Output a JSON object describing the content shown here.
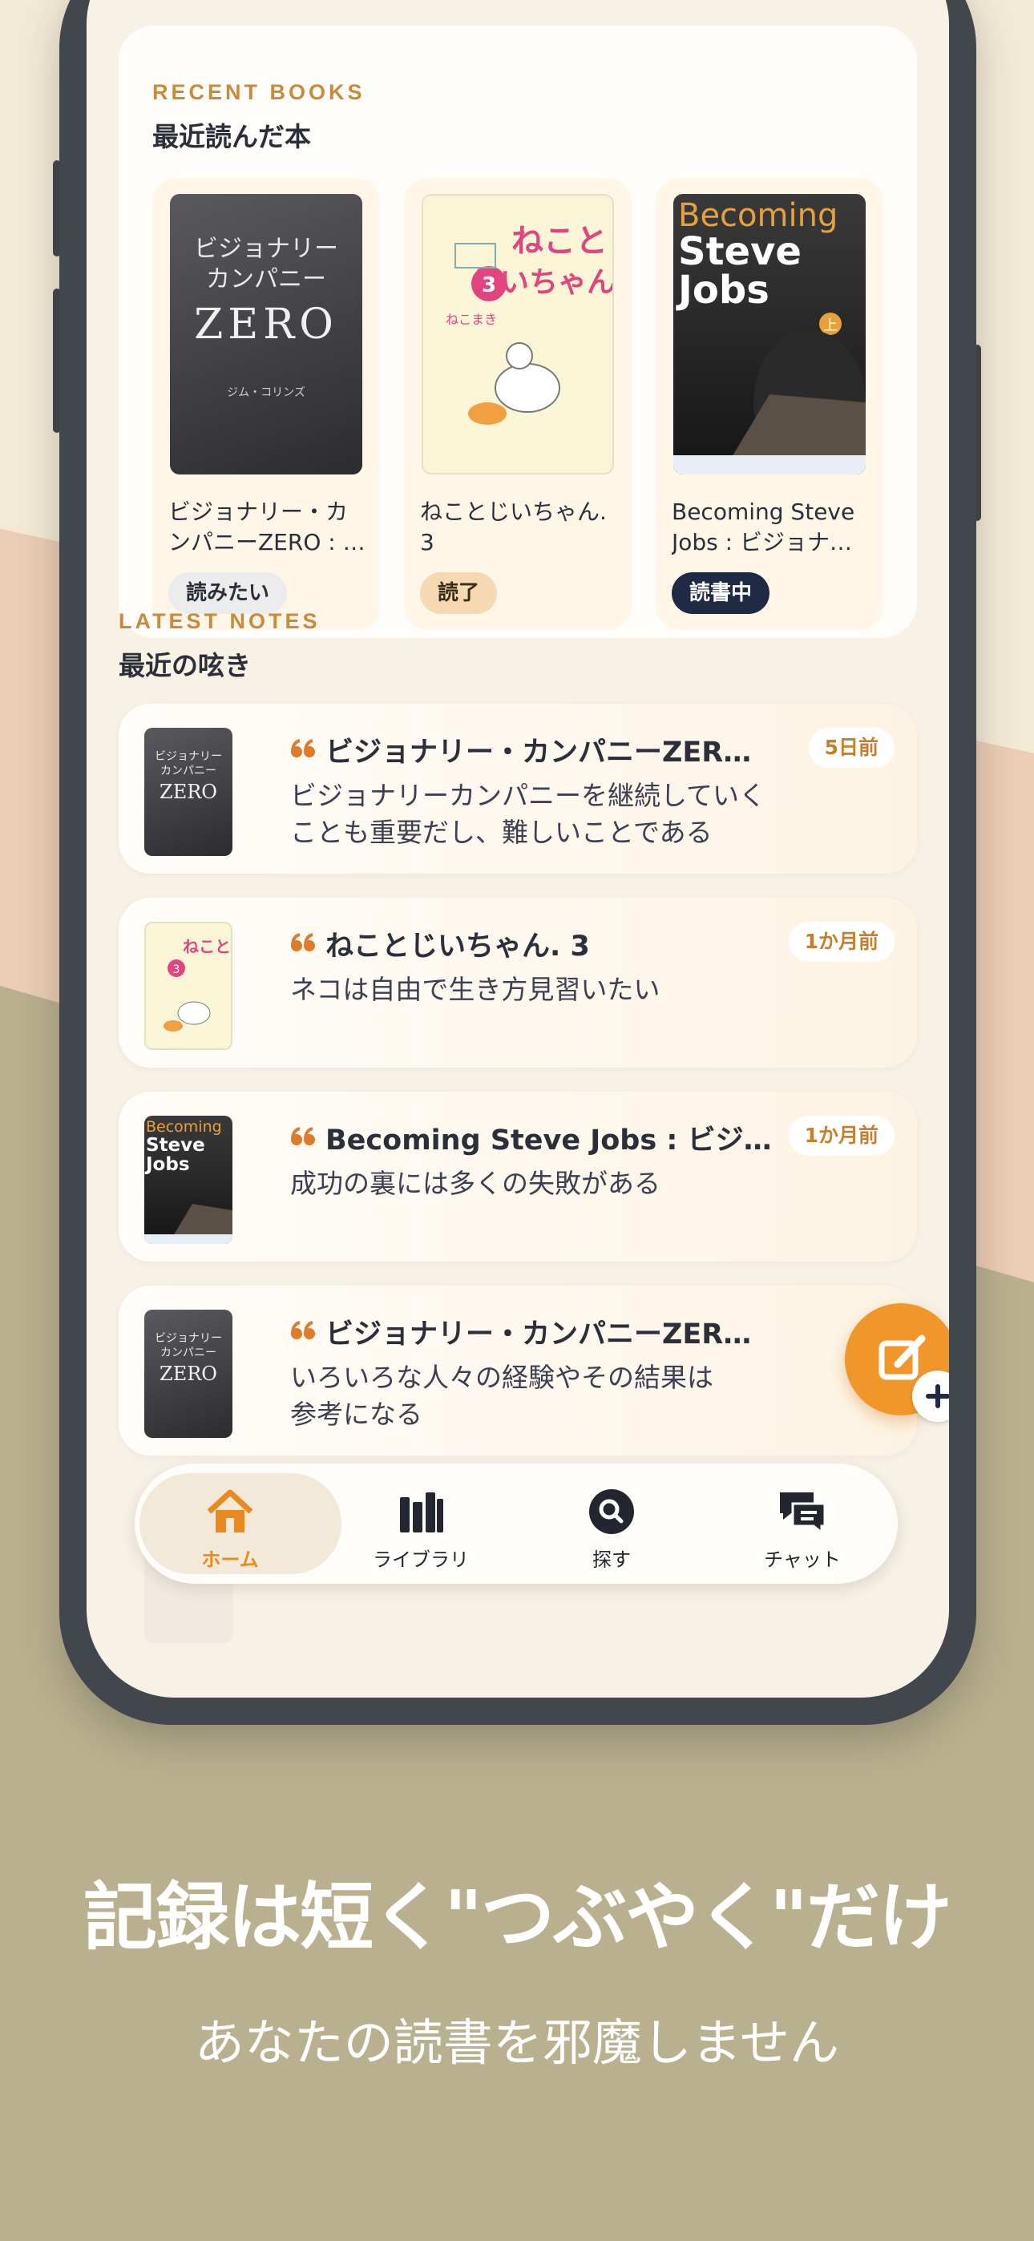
{
  "recent_books": {
    "eyebrow": "RECENT BOOKS",
    "title": "最近読んだ本",
    "items": [
      {
        "title": "ビジョナリー・カンパニーZERO : ゼロから事業を生み出し、偉大で永続的な企業になる",
        "status": "読みたい",
        "status_bg": "#ececec",
        "status_fg": "#2b2f3a"
      },
      {
        "title": "ねことじいちゃん. 3",
        "status": "読了",
        "status_bg": "#f6d9b0",
        "status_fg": "#3a2c18"
      },
      {
        "title": "Becoming Steve Jobs : ビジョナリーへの成長物語",
        "status": "読書中",
        "status_bg": "#1f2a44",
        "status_fg": "#ffffff"
      }
    ]
  },
  "latest_notes": {
    "eyebrow": "LATEST NOTES",
    "title": "最近の呟き",
    "items": [
      {
        "book": "ビジョナリー・カンパニーZERO : ゼロから事業を生み出し",
        "text": "ビジョナリーカンパニーを継続していくことも重要だし、難しいことである",
        "time": "5日前"
      },
      {
        "book": "ねことじいちゃん. 3",
        "text": "ネコは自由で生き方見習いたい",
        "time": "1か月前"
      },
      {
        "book": "Becoming Steve Jobs : ビジョナリーへの成長物語",
        "text": "成功の裏には多くの失敗がある",
        "time": "1か月前"
      },
      {
        "book": "ビジョナリー・カンパニーZERO : ゼロから事業を生み出し",
        "text": "いろいろな人々の経験やその結果は参考になる",
        "time": ""
      }
    ]
  },
  "covers": {
    "zero": {
      "line1": "ビジョナリー",
      "line2": "カンパニー",
      "line3": "ZERO",
      "author": "ジム・コリンズ"
    },
    "neko": {
      "line1": "ねこと",
      "line2": "じいちゃん",
      "num": "3",
      "author": "ねこまき"
    },
    "jobs": {
      "line1": "Becoming",
      "line2": "Steve",
      "line3": "Jobs",
      "tag": "上"
    }
  },
  "tabs": [
    {
      "label": "ホーム",
      "icon": "home-icon"
    },
    {
      "label": "ライブラリ",
      "icon": "library-icon"
    },
    {
      "label": "探す",
      "icon": "search-icon"
    },
    {
      "label": "チャット",
      "icon": "chat-icon"
    }
  ],
  "marketing": {
    "headline": "記録は短く\"つぶやく\"だけ",
    "subline": "あなたの読書を邪魔しません"
  },
  "colors": {
    "accent": "#f0962a",
    "eyebrow": "#c98a3a",
    "navy": "#1f2a44"
  }
}
